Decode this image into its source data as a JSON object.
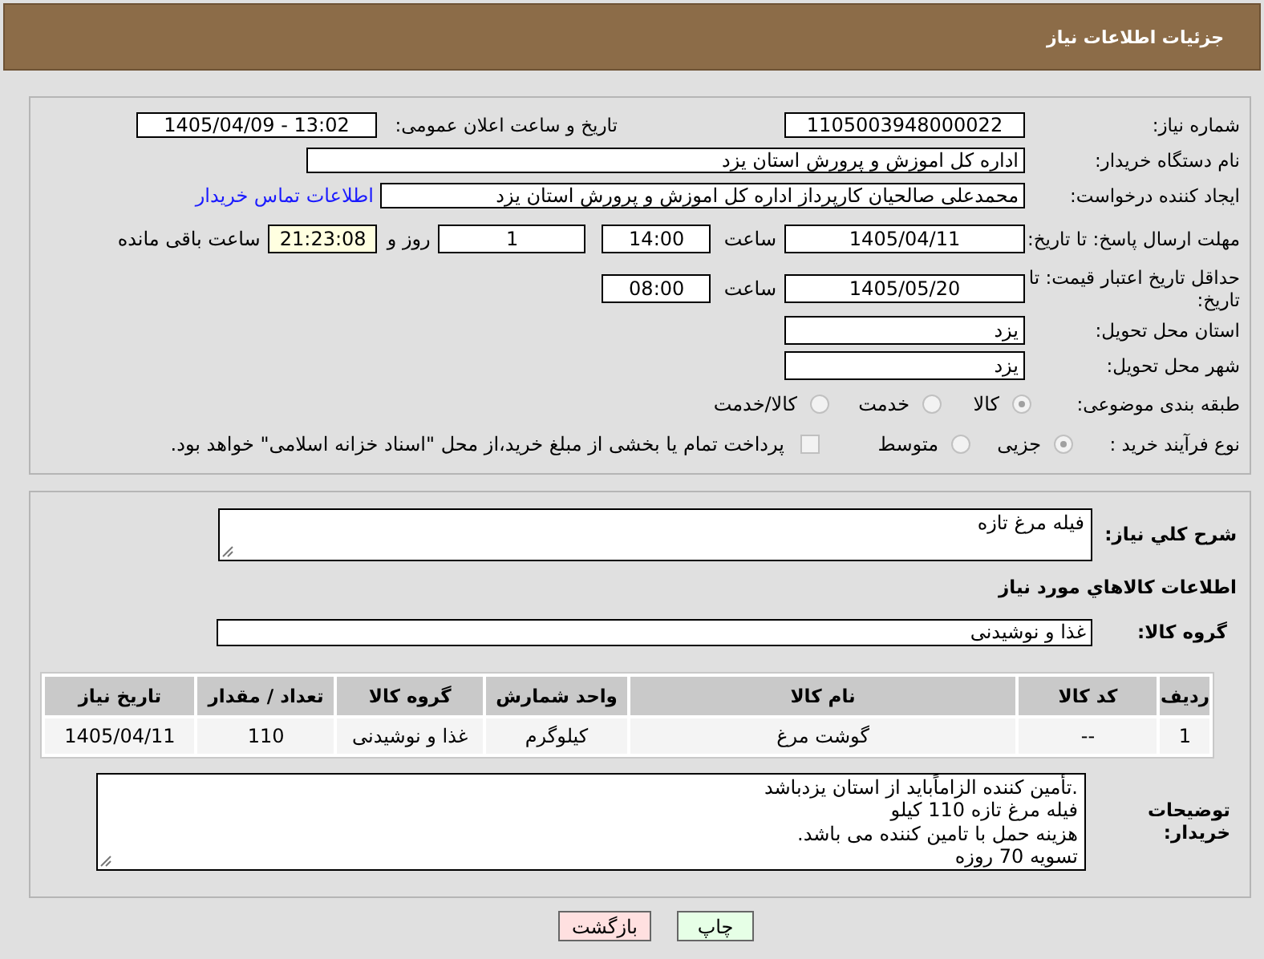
{
  "header": {
    "title": "جزئیات اطلاعات نیاز"
  },
  "need_number": {
    "label": "شماره نیاز:",
    "value": "1105003948000022"
  },
  "announce": {
    "label": "تاریخ و ساعت اعلان عمومی:",
    "value": "1405/04/09 - 13:02"
  },
  "buyer": {
    "label": "نام دستگاه خریدار:",
    "value": "اداره کل اموزش و پرورش استان یزد"
  },
  "requester": {
    "label": "ایجاد کننده درخواست:",
    "value": "محمدعلی صالحیان کارپرداز اداره کل اموزش و پرورش استان یزد",
    "link": "اطلاعات تماس خریدار"
  },
  "deadline": {
    "label": "مهلت ارسال پاسخ: تا تاریخ:",
    "date": "1405/04/11",
    "time_label": "ساعت",
    "time": "14:00",
    "days": "1",
    "days_label": "روز و",
    "remaining": "21:23:08",
    "remaining_label": "ساعت باقی مانده"
  },
  "validity": {
    "label": "حداقل تاریخ اعتبار قیمت: تا تاریخ:",
    "date": "1405/05/20",
    "time_label": "ساعت",
    "time": "08:00"
  },
  "province": {
    "label": "استان محل تحویل:",
    "value": "یزد"
  },
  "city": {
    "label": "شهر محل تحویل:",
    "value": "یزد"
  },
  "category": {
    "label": "طبقه بندی موضوعی:",
    "options": [
      {
        "label": "کالا",
        "selected": true
      },
      {
        "label": "خدمت",
        "selected": false
      },
      {
        "label": "کالا/خدمت",
        "selected": false
      }
    ]
  },
  "process": {
    "label": "نوع فرآیند خرید :",
    "options": [
      {
        "label": "جزیی",
        "selected": true
      },
      {
        "label": "متوسط",
        "selected": false
      }
    ],
    "payment": {
      "label": "پرداخت تمام یا بخشی از مبلغ خرید،از محل \"اسناد خزانه اسلامی\" خواهد بود.",
      "checked": false
    }
  },
  "description": {
    "label": "شرح كلي نياز:",
    "value": "فیله مرغ تازه"
  },
  "goods_heading": "اطلاعات كالاهاي مورد نياز",
  "goods_group": {
    "label": "گروه کالا:",
    "value": "غذا و نوشیدنی"
  },
  "table": {
    "columns": [
      "ردیف",
      "کد کالا",
      "نام کالا",
      "واحد شمارش",
      "گروه کالا",
      "تعداد / مقدار",
      "تاریخ نیاز"
    ],
    "rows": [
      [
        "1",
        "--",
        "گوشت مرغ",
        "کیلوگرم",
        "غذا و نوشیدنی",
        "110",
        "1405/04/11"
      ]
    ]
  },
  "buyer_notes": {
    "label": "توضیحات خریدار:",
    "value": ".تأمین کننده الزاماًباید از استان یزدباشد\nفیله مرغ تازه 110 کیلو\nهزینه حمل با تامین کننده می باشد.\nتسویه 70 روزه"
  },
  "buttons": [
    {
      "label": "چاپ",
      "kind": "print"
    },
    {
      "label": "بازگشت",
      "kind": "back"
    }
  ]
}
